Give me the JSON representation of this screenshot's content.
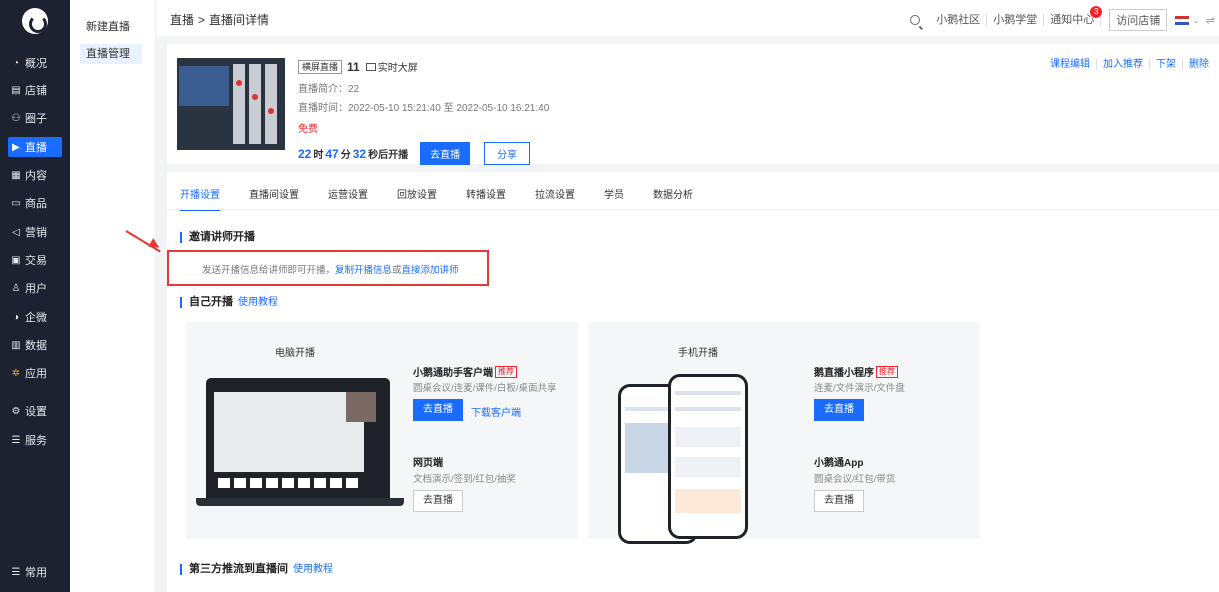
{
  "nav": {
    "items": [
      {
        "icon": "◔",
        "icon_name": "overview-icon",
        "label": "概况"
      },
      {
        "icon": "▤",
        "icon_name": "shop-icon",
        "label": "店铺"
      },
      {
        "icon": "⚇",
        "icon_name": "circle-icon",
        "label": "圈子"
      },
      {
        "icon": "▶",
        "icon_name": "live-icon",
        "label": "直播",
        "active": true
      },
      {
        "icon": "▦",
        "icon_name": "content-icon",
        "label": "内容"
      },
      {
        "icon": "▭",
        "icon_name": "goods-icon",
        "label": "商品"
      },
      {
        "icon": "◁",
        "icon_name": "marketing-icon",
        "label": "营销"
      },
      {
        "icon": "▣",
        "icon_name": "trade-icon",
        "label": "交易"
      },
      {
        "icon": "♙",
        "icon_name": "user-icon",
        "label": "用户"
      },
      {
        "icon": "◑",
        "icon_name": "wecom-icon",
        "label": "企微"
      },
      {
        "icon": "▥",
        "icon_name": "data-icon",
        "label": "数据"
      },
      {
        "icon": "✲",
        "icon_name": "apps-icon",
        "label": "应用"
      },
      {
        "icon": "⚙",
        "icon_name": "settings-icon",
        "label": "设置"
      },
      {
        "icon": "☰",
        "icon_name": "service-icon",
        "label": "服务"
      }
    ],
    "bottom": {
      "icon": "☰",
      "label": "常用"
    }
  },
  "submenu": {
    "items": [
      "新建直播",
      "直播管理"
    ]
  },
  "header": {
    "crumb_root": "直播",
    "crumb_sep": ">",
    "crumb_current": "直播间详情",
    "links": [
      "小鹅社区",
      "小鹅学堂",
      "通知中心"
    ],
    "notify_count": "3",
    "visit_shop": "访问店铺"
  },
  "card": {
    "tag": "横屏直播",
    "id": "11",
    "screen_label": "实时大屏",
    "intro": "直播简介：22",
    "time": "直播时间：2022-05-10 15:21:40 至 2022-05-10 16:21:40",
    "price": "免费",
    "countdown": {
      "d": "22",
      "d_unit": "时",
      "m": "47",
      "m_unit": "分",
      "s": "32",
      "s_unit": "秒后开播"
    },
    "go_live": "去直播",
    "share": "分享",
    "actions": [
      "课程编辑",
      "加入推荐",
      "下架",
      "删除"
    ]
  },
  "tabs": [
    "开播设置",
    "直播间设置",
    "运营设置",
    "回放设置",
    "转播设置",
    "拉流设置",
    "学员",
    "数据分析"
  ],
  "invite": {
    "title": "邀请讲师开播",
    "text": "发送开播信息给讲师即可开播，",
    "link1": "复制开播信息",
    "or": "或",
    "link2": "直接添加讲师"
  },
  "self_live": {
    "title": "自己开播",
    "tutorial": "使用教程"
  },
  "pc": {
    "title": "电脑开播",
    "app_title": "小鹅通助手客户端",
    "recommend": "推荐",
    "app_desc": "圆桌会议/连麦/课件/白板/桌面共享",
    "go": "去直播",
    "download": "下载客户端",
    "web_title": "网页端",
    "web_desc": "文档演示/签到/红包/抽奖",
    "web_go": "去直播"
  },
  "mobile": {
    "title": "手机开播",
    "mini_title": "鹅直播小程序",
    "recommend": "推荐",
    "mini_desc": "连麦/文件演示/文件盘",
    "go": "去直播",
    "app_title": "小鹅通App",
    "app_desc": "圆桌会议/红包/带货",
    "app_go": "去直播"
  },
  "third": {
    "title": "第三方推流到直播间",
    "tutorial": "使用教程"
  },
  "colors": {
    "accent": "#1a6cff",
    "nav_bg": "#1c2230",
    "highlight": "#e53935"
  }
}
